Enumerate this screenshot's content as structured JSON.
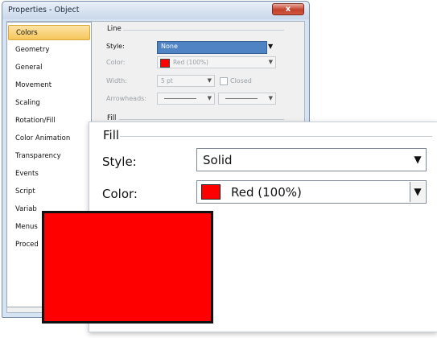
{
  "window": {
    "title": "Properties - Object",
    "close_glyph": "x"
  },
  "sidebar": {
    "items": [
      {
        "label": "Colors",
        "selected": true
      },
      {
        "label": "Geometry"
      },
      {
        "label": "General"
      },
      {
        "label": "Movement"
      },
      {
        "label": "Scaling"
      },
      {
        "label": "Rotation/Fill"
      },
      {
        "label": "Color Animation"
      },
      {
        "label": "Transparency"
      },
      {
        "label": "Events"
      },
      {
        "label": "Script"
      },
      {
        "label": "Variab"
      },
      {
        "label": "Menus"
      },
      {
        "label": "Proced"
      }
    ]
  },
  "line_group": {
    "title": "Line",
    "style_label": "Style:",
    "style_value": "None",
    "color_label": "Color:",
    "color_value": "Red (100%)",
    "width_label": "Width:",
    "width_value": "5 pt",
    "closed_label": "Closed",
    "arrowheads_label": "Arrowheads:"
  },
  "fill_group_small": {
    "title": "Fill"
  },
  "fill_panel": {
    "title": "Fill",
    "style_label": "Style:",
    "style_value": "Solid",
    "color_label": "Color:",
    "color_value": "Red (100%)"
  },
  "colors": {
    "swatch": "#ff0000",
    "selection": "#4f83c4",
    "nav_selected": "#f6c65a"
  },
  "icons": {
    "dropdown": "▼",
    "close": "x"
  }
}
